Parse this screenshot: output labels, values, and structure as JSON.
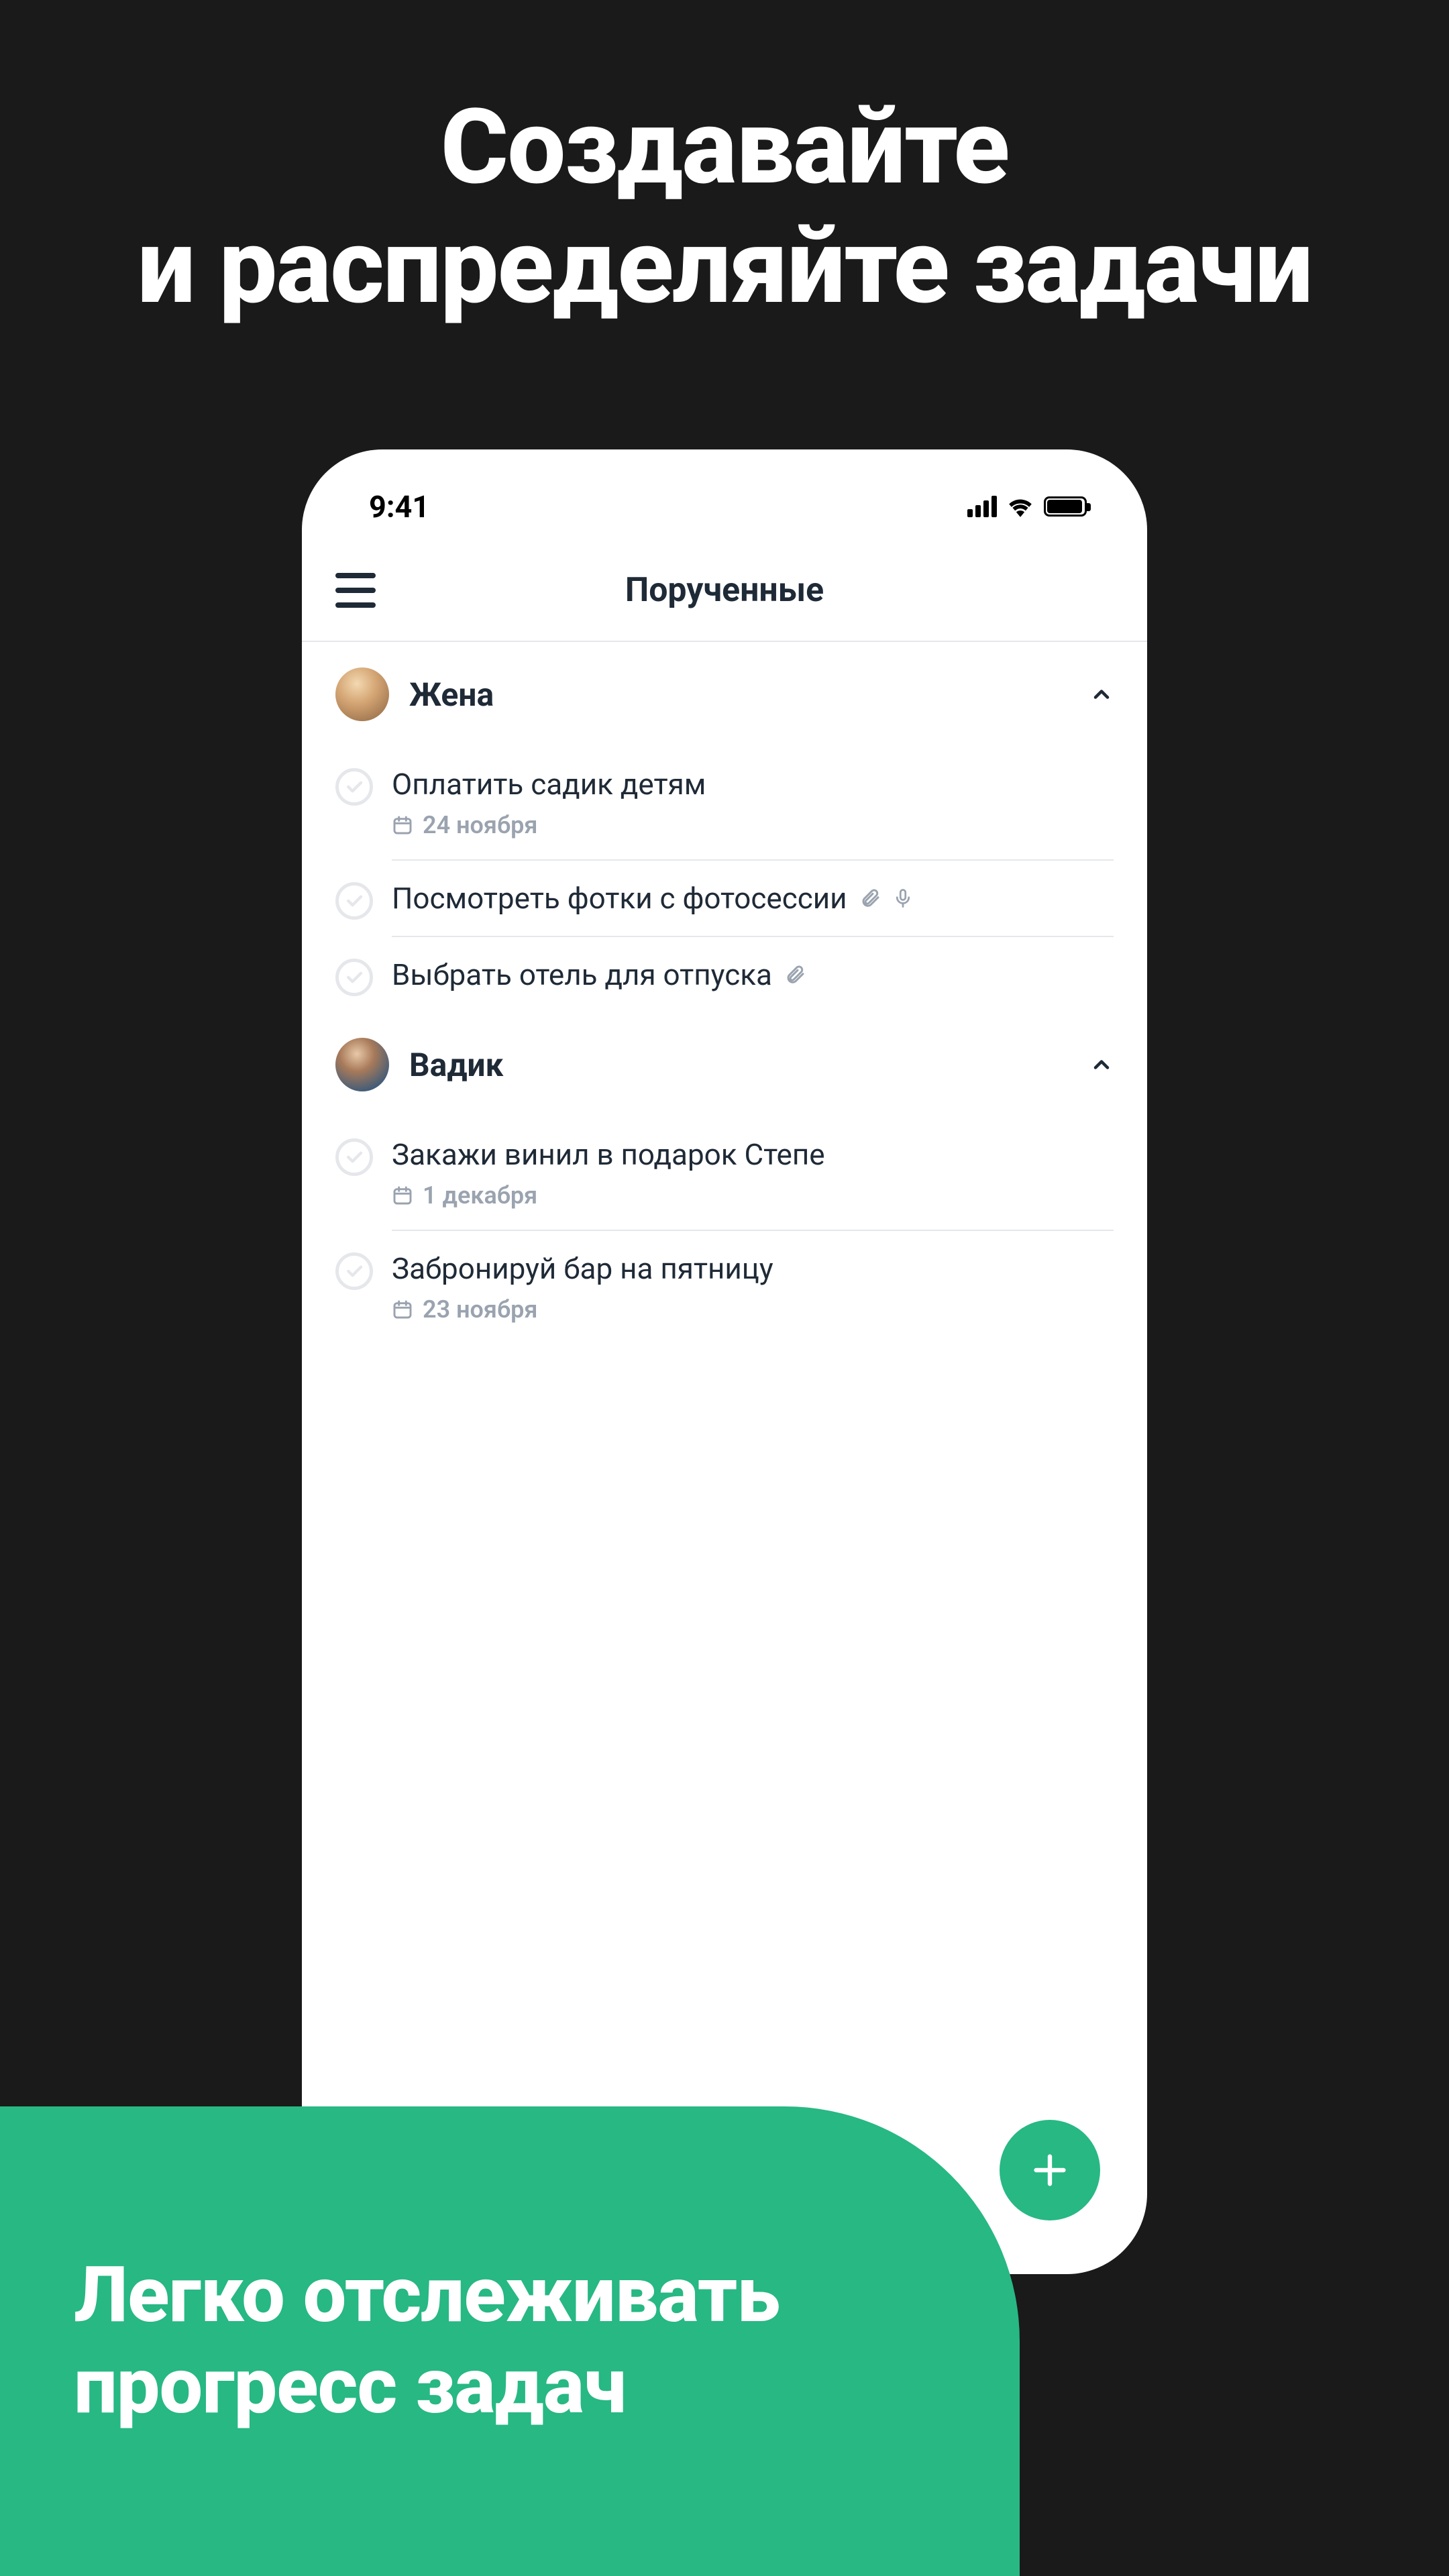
{
  "promo": {
    "headline_line1": "Создавайте",
    "headline_line2": "и распределяйте задачи"
  },
  "status_bar": {
    "time": "9:41"
  },
  "nav": {
    "title": "Порученные"
  },
  "sections": [
    {
      "name": "Жена",
      "avatar": "wife",
      "tasks": [
        {
          "title": "Оплатить садик детям",
          "date": "24 ноября",
          "attachment": false,
          "voice": false
        },
        {
          "title": "Посмотреть фотки с фотосессии",
          "date": null,
          "attachment": true,
          "voice": true
        },
        {
          "title": "Выбрать отель для отпуска",
          "date": null,
          "attachment": true,
          "voice": false
        }
      ]
    },
    {
      "name": "Вадик",
      "avatar": "vadik",
      "tasks": [
        {
          "title": "Закажи винил в подарок Степе",
          "date": "1 декабря",
          "attachment": false,
          "voice": false
        },
        {
          "title": "Забронируй бар на пятницу",
          "date": "23 ноября",
          "attachment": false,
          "voice": false
        }
      ]
    }
  ],
  "banner": {
    "line1": "Легко отслеживать",
    "line2": "прогресс задач"
  },
  "colors": {
    "accent": "#27b884",
    "bg_dark": "#1a1a1a"
  }
}
